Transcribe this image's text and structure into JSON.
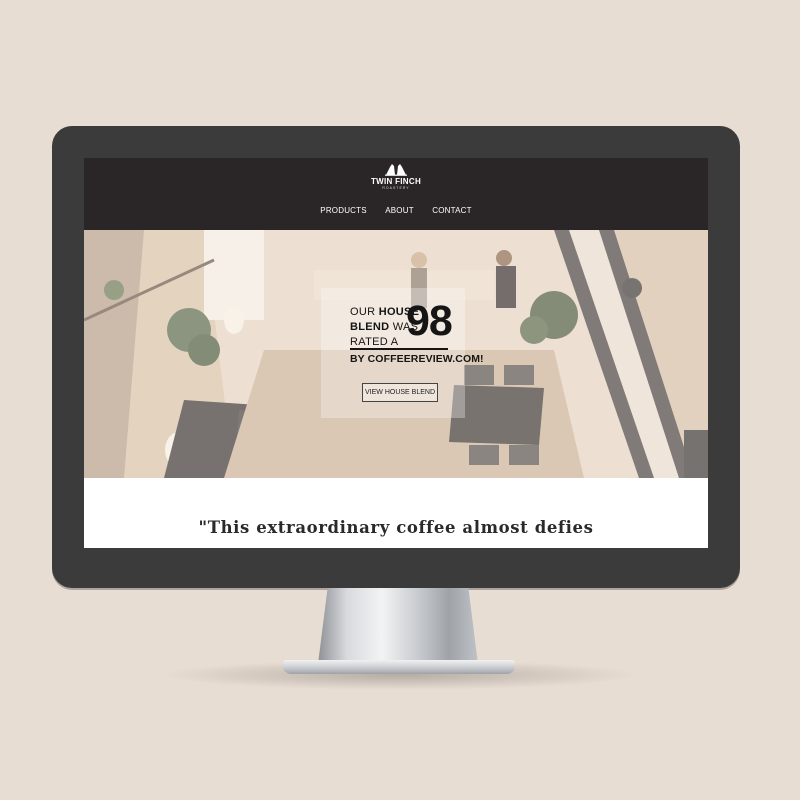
{
  "brand": {
    "name": "TWIN FINCH",
    "tagline": "ROASTERY"
  },
  "nav": {
    "items": [
      "PRODUCTS",
      "ABOUT",
      "CONTACT"
    ]
  },
  "hero": {
    "headline_line1_a": "OUR ",
    "headline_line1_b": "HOUSE",
    "headline_line2_a": "BLEND",
    "headline_line2_b": " WAS",
    "headline_line3": "RATED A",
    "score": "98",
    "byline": "BY COFFEEREVIEW.COM!",
    "cta_label": "VIEW HOUSE BLEND"
  },
  "quote": {
    "text": "\"This extraordinary coffee almost defies"
  },
  "colors": {
    "page_background": "#e8ddd3",
    "monitor_bezel": "#3b3b3b",
    "header_background": "#2a2526",
    "hero_tone": "#efe3d4",
    "text_dark": "#151515"
  }
}
